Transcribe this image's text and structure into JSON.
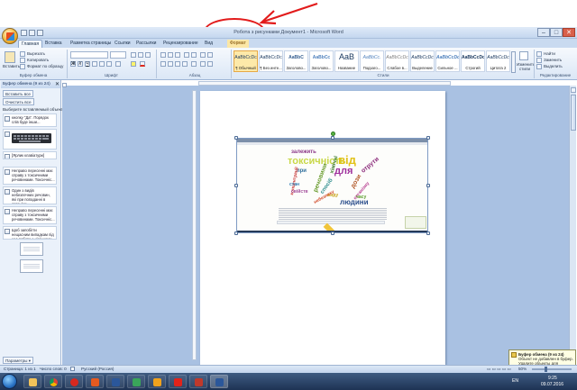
{
  "window": {
    "title": "Робота з рисунками  Документ1 - Microsoft Word",
    "minimize": "–",
    "maximize": "□",
    "close": "✕"
  },
  "tabs": [
    "Главная",
    "Вставка",
    "Разметка страницы",
    "Ссылки",
    "Рассылки",
    "Рецензирование",
    "Вид",
    "Формат"
  ],
  "ribbon": {
    "clipboard": {
      "paste": "Вставить",
      "cut": "Вырезать",
      "copy": "Копировать",
      "format_painter": "Формат по образцу",
      "label": "Буфер обмена"
    },
    "font": {
      "family": "",
      "size": "",
      "label": "Шрифт"
    },
    "paragraph": {
      "label": "Абзац"
    },
    "styles": {
      "label": "Стили",
      "items": [
        {
          "sample": "AaBbCcDc",
          "name": "¶ Обычный"
        },
        {
          "sample": "AaBbCcDc",
          "name": "¶ Без инте..."
        },
        {
          "sample": "AaBbC",
          "name": "Заголово..."
        },
        {
          "sample": "AaBbCc",
          "name": "Заголово..."
        },
        {
          "sample": "AaB",
          "name": "Название"
        },
        {
          "sample": "AaBbCc.",
          "name": "Подзаго..."
        },
        {
          "sample": "AaBbCcDc",
          "name": "Слабое в..."
        },
        {
          "sample": "AaBbCcDc",
          "name": "Выделение"
        },
        {
          "sample": "AaBbCcDc",
          "name": "Сильное ..."
        },
        {
          "sample": "AaBbCcDc",
          "name": "Строгий"
        },
        {
          "sample": "AaBbCcDc",
          "name": "Цитата 2"
        }
      ],
      "change_styles": "Изменить стили"
    },
    "editing": {
      "find": "Найти",
      "replace": "Заменить",
      "select": "Выделить",
      "label": "Редактирование"
    }
  },
  "pane": {
    "title": "Буфер обмена (9 из 24)",
    "paste_all": "Вставить все",
    "clear_all": "Очистить все",
    "hint": "Выберите вставляемый объект:",
    "items": [
      "кнопку \"Да\". Порядок слів буде інши...",
      "",
      "[Ярлик клавіатури]",
      "Неправо пересенні має справу з токсичними речовинами. Токсичніс...",
      "Один з видів небезпечних речовин, які при попаданні в організм...",
      "Неправо пересенні має справу з токсичними речовинами. Токсичніс...",
      "Щоб запобігти нещасним випадкам під час роботи з хімічними речовинами..."
    ],
    "options": "Параметры ▾"
  },
  "image": {
    "words": [
      "залежить",
      "токсичність",
      "від",
      "для",
      "при",
      "речовини",
      "дози",
      "спосіб",
      "людини",
      "концентрації",
      "отрути",
      "свійств",
      "хімічні",
      "організму",
      "стан",
      "виду",
      "часу",
      "небезпеку"
    ]
  },
  "status": {
    "page": "Страница: 1 из 1",
    "words": "Число слов: 0",
    "lang": "Русский (Россия)",
    "zoom": "50%"
  },
  "notification": {
    "title": "Буфер обмена (9 из 24)",
    "text": "Объект не добавлен в буфер. Удалите объекты для увеличения доступного места."
  },
  "taskbar": {
    "lang": "EN",
    "time": "9:25",
    "date": "09.07.2016"
  },
  "colors": {
    "accent": "#2b579a",
    "annotation": "#e21b1b"
  }
}
